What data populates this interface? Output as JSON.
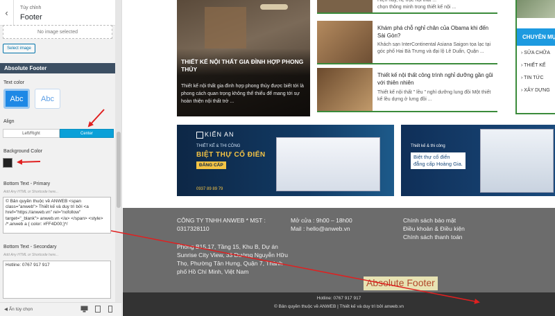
{
  "panel": {
    "back_symbol": "‹",
    "breadcrumb": "Tùy chỉnh",
    "title": "Footer",
    "no_image": "No image selected",
    "select_image": "Select image",
    "section_title": "Absolute Footer",
    "text_color_label": "Text color",
    "text_color_dark": "Abc",
    "text_color_light": "Abc",
    "align_label": "Align",
    "align_left": "Left/Right",
    "align_center": "Center",
    "align_selected": "Center",
    "bg_color_label": "Background Color",
    "bg_color": "#222222",
    "primary_label": "Bottom Text - Primary",
    "primary_hint": "Add Any HTML or Shortcode here...",
    "primary_value": "© Bản quyền thuộc về ANWEB <span class=\"anweb\"> Thiết kế và duy trì bởi <a href=\"https://anweb.vn\" rel=\"nofollow\" target=\"_blank\"> anweb.vn </a> </span> <style> /*.anweb a { color: #FF4D00;}*/",
    "secondary_label": "Bottom Text - Secondary",
    "secondary_hint": "Add Any HTML or Shortcode here...",
    "secondary_value": "Hotline: 0767 917 917",
    "hide_controls": "Ẩn tùy chọn"
  },
  "preview": {
    "featured": {
      "title": "THIẾT KẾ NỘI THẤT GIA ĐÌNH HỢP PHONG THỦY",
      "excerpt": "Thiết kế nội thất gia đình hợp phong thủy được biết tới là phong cách quan trọng không thể thiếu để mang tới sự hoàn thiện nội thất trở ..."
    },
    "news": [
      {
        "title": "",
        "excerpt": "Hiện nay, hệ trục nội thất ...\nchọn thông minh trong thiết kế nội ..."
      },
      {
        "title": "Khám phá chỗ nghỉ chân của Obama khi đến Sài Gòn?",
        "excerpt": "Khách sạn InterContinental Asiana Saigon tọa lạc tại góc phố Hai Bà Trưng và đại lộ Lê Duẩn, Quận ..."
      },
      {
        "title": "Thiết kế nội thất công trình nghỉ dưỡng gần gũi với thiên nhiên",
        "excerpt": "Thiết kế nội thất \" lều \" nghỉ dưỡng lung đồi Một thiết kế lều dựng ở lưng đồi ..."
      }
    ],
    "sidebar": {
      "heading": "CHUYÊN MỤC",
      "items": [
        "SỬA CHỮA",
        "THIẾT KẾ",
        "TIN TỨC",
        "XÂY DỰNG"
      ]
    },
    "banner1": {
      "logo": "KIẾN AN",
      "line1": "THIẾT KẾ & THI CÔNG",
      "line2": "BIỆT THỰ CỔ ĐIỂN",
      "tag": "ĐẲNG CẤP",
      "phone": "0937 89 89 79"
    },
    "banner2": {
      "line1": "Thiết kế & thi công",
      "line2": "Biệt thự cổ điển",
      "line3": "đẳng cấp Hoàng Gia."
    },
    "footer": {
      "company": "CÔNG TY TNHH ANWEB * MST : 0317328110",
      "address": "Phòng B15.17, Tầng 15, Khu B, Dự án Sunrise City View, 33 Đường Nguyễn Hữu Thọ, Phường Tân Hưng, Quận 7, Thành phố Hồ Chí Minh, Việt Nam",
      "hours": "Mở cửa : 9h00 – 18h00",
      "mail": "Mail : hello@anweb.vn",
      "links": [
        "Chính sách bảo mật",
        "Điều khoản & Điều kiện",
        "Chính sách thanh toán"
      ],
      "hotline": "Hotline: 0767 917 917",
      "copyright": "© Bản quyền thuộc về ANWEB  |  Thiết kế và duy trì bởi anweb.vn"
    },
    "annotation": "Absolute Footer"
  },
  "colors": {
    "accent_blue": "#1d9ae0",
    "section_bg": "#3c4f63",
    "footer_top": "#6c6c6c",
    "footer_bottom": "#333333",
    "arrow_red": "#e02020",
    "green_border": "#3a8a3a"
  }
}
